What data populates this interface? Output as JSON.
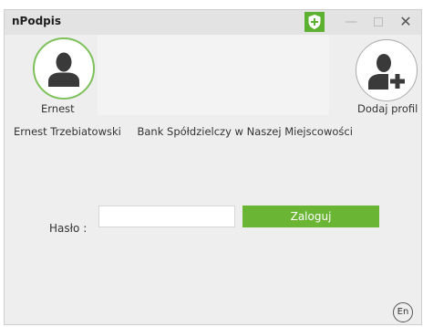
{
  "window": {
    "title": "nPodpis"
  },
  "titlebar": {
    "shield_icon": "shield-icon",
    "minimize_icon": "minimize-icon",
    "maximize_icon": "maximize-icon",
    "close_label": "✕"
  },
  "profiles": {
    "user": {
      "name": "Ernest",
      "icon": "user-icon",
      "selected": true
    },
    "add": {
      "label": "Dodaj profil",
      "icon": "add-user-icon"
    }
  },
  "account": {
    "full_name": "Ernest  Trzebiatowski",
    "bank": "Bank Spółdzielczy w Naszej Miejscowości"
  },
  "login": {
    "password_label": "Hasło :",
    "password_value": "",
    "button_label": "Zaloguj"
  },
  "language": {
    "label": "En"
  },
  "colors": {
    "accent": "#6ab533",
    "selected_ring": "#7ec05a",
    "background": "#eeeeee",
    "titlebar": "#e3e3e3"
  }
}
